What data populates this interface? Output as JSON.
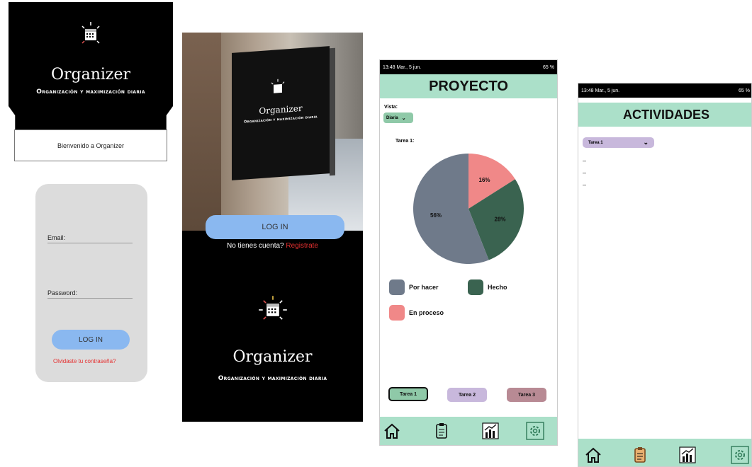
{
  "screen1": {
    "app_name": "Organizer",
    "tagline": "Organización y maximización diaria",
    "welcome": "Bienvenido a Organizer",
    "email_label": "Email:",
    "password_label": "Password:",
    "login_button": "LOG IN",
    "forgot_link": "Olvidaste tu contraseña?"
  },
  "screen2": {
    "sign_title": "Organizer",
    "sign_tagline": "Organización y maximización diaria",
    "login_button": "LOG IN",
    "no_account_text": "No tienes cuenta?",
    "register_link": "Registrate",
    "app_name": "Organizer",
    "tagline": "Organización y maximización diaria"
  },
  "screen3": {
    "status_time": "13:48 Mar., 5 jun.",
    "status_battery": "65 %",
    "title": "PROYECTO",
    "view_label": "Vista:",
    "view_select": "Diaria",
    "task_label": "Tarea 1:",
    "legend": [
      {
        "label": "Por hacer",
        "color": "#6f7a8a"
      },
      {
        "label": "Hecho",
        "color": "#3a6350"
      },
      {
        "label": "En proceso",
        "color": "#f08888"
      }
    ],
    "tabs": [
      "Tarea 1",
      "Tarea 2",
      "Tarea 3"
    ],
    "chart_data": {
      "type": "pie",
      "categories": [
        "Por hacer",
        "Hecho",
        "En proceso"
      ],
      "values": [
        56,
        28,
        16
      ],
      "labels": [
        "56%",
        "28%",
        "16%"
      ],
      "colors": [
        "#6f7a8a",
        "#3a6350",
        "#f08888"
      ]
    }
  },
  "screen4": {
    "status_time": "13:48 Mar., 5 jun.",
    "status_battery": "65 %",
    "title": "ACTIVIDADES",
    "task_select": "Tarea 1",
    "items": [
      "–",
      "–",
      "–"
    ]
  },
  "colors": {
    "mint": "#abe0c9",
    "login_blue": "#8ab8f0",
    "link_red": "#e53030",
    "tab1": "#8fc9a8",
    "tab2": "#c8b8dc",
    "tab3": "#b88a94"
  }
}
